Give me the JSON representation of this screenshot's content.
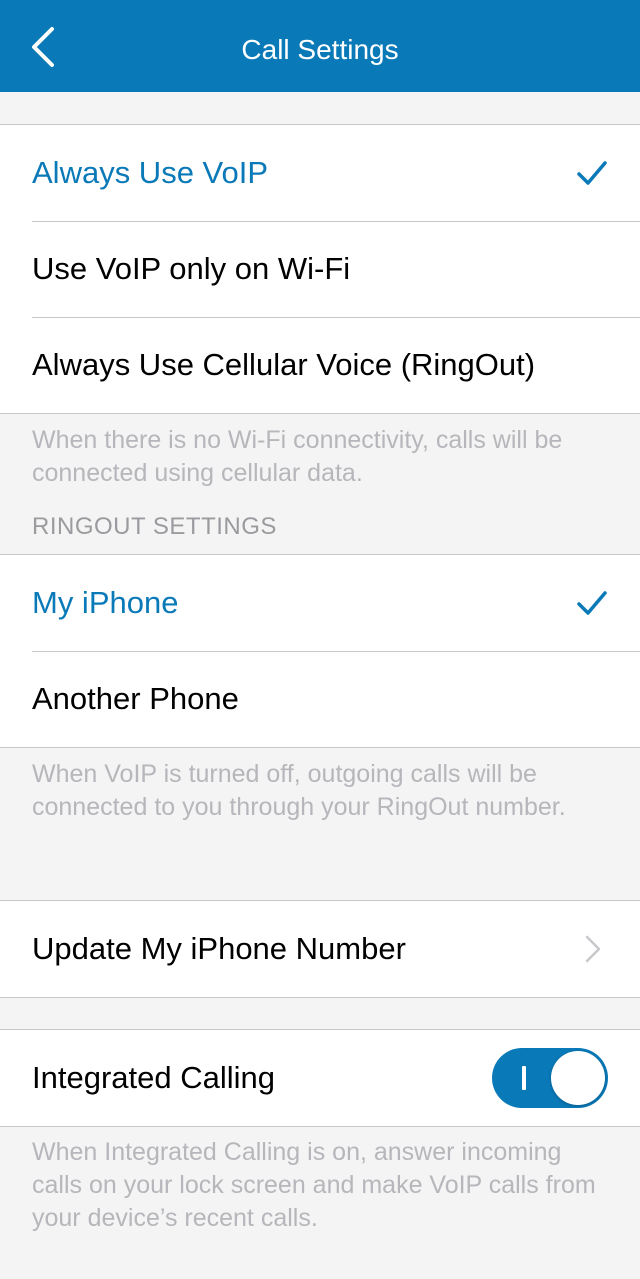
{
  "theme": {
    "accent": "#0979b8",
    "background": "#f4f4f4",
    "separator": "#c8c7cc",
    "footer_text": "#b6b6bb"
  },
  "nav": {
    "title": "Call Settings",
    "back_icon": "chevron-left-icon"
  },
  "voip_mode": {
    "options": [
      {
        "label": "Always Use VoIP",
        "selected": true
      },
      {
        "label": "Use VoIP only on Wi-Fi",
        "selected": false
      },
      {
        "label": "Always Use Cellular Voice (RingOut)",
        "selected": false
      }
    ],
    "footer": "When there is no Wi-Fi connectivity, calls will be connected using cellular data."
  },
  "ringout": {
    "header": "RINGOUT SETTINGS",
    "options": [
      {
        "label": "My iPhone",
        "selected": true
      },
      {
        "label": "Another Phone",
        "selected": false
      }
    ],
    "footer": "When VoIP is turned off, outgoing calls will be connected to you through your RingOut number."
  },
  "update_number": {
    "label": "Update My iPhone Number",
    "icon": "chevron-right-icon"
  },
  "integrated_calling": {
    "label": "Integrated Calling",
    "enabled": true,
    "footer": "When Integrated Calling is on, answer incoming calls on your lock screen and make VoIP calls from your device’s recent calls."
  }
}
